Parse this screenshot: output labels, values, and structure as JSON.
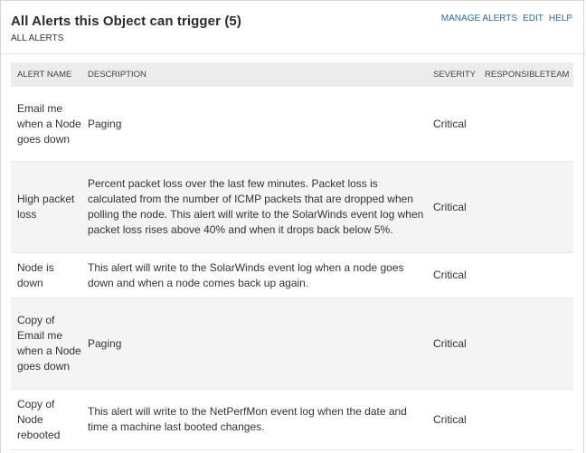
{
  "header": {
    "title": "All Alerts this Object can trigger (5)",
    "subtitle": "ALL ALERTS",
    "links": {
      "manage": "MANAGE ALERTS",
      "edit": "EDIT",
      "help": "HELP"
    }
  },
  "table": {
    "columns": {
      "name": "ALERT NAME",
      "description": "DESCRIPTION",
      "severity": "SEVERITY",
      "team": "RESPONSIBLETEAM"
    },
    "rows": [
      {
        "name": "Email me when a Node goes down",
        "description": "Paging",
        "severity": "Critical",
        "team": ""
      },
      {
        "name": "High packet loss",
        "description": "Percent packet loss over the last few minutes. Packet loss is calculated from the number of ICMP packets that are dropped when polling the node. This alert will write to the SolarWinds event log when packet loss rises above 40% and when it drops back below 5%.",
        "severity": "Critical",
        "team": ""
      },
      {
        "name": "Node is down",
        "description": "This alert will write to the SolarWinds event log when a node goes down and when a node comes back up again.",
        "severity": "Critical",
        "team": ""
      },
      {
        "name": "Copy of Email me when a Node goes down",
        "description": "Paging",
        "severity": "Critical",
        "team": ""
      },
      {
        "name": "Copy of Node rebooted",
        "description": "This alert will write to the NetPerfMon event log when the date and time a machine last booted changes.",
        "severity": "Critical",
        "team": ""
      }
    ]
  }
}
